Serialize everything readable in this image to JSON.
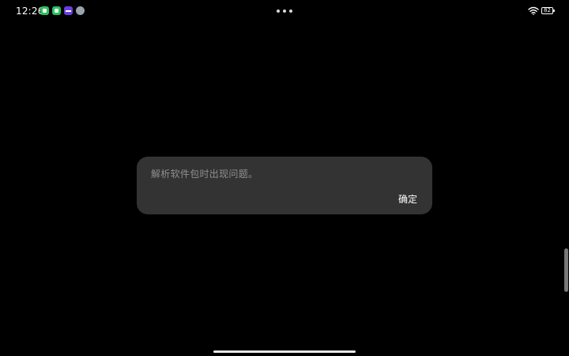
{
  "status_bar": {
    "time": "12:26",
    "notification_icons": [
      "message-app-icon",
      "wechat-icon",
      "purple-app-icon",
      "avatar-app-icon"
    ],
    "battery_level": "82"
  },
  "dialog": {
    "message": "解析软件包时出现问题。",
    "confirm_label": "确定"
  },
  "colors": {
    "background": "#000000",
    "dialog_background": "#333333",
    "message_text": "#8f8f8f",
    "button_text": "#ffffff"
  }
}
